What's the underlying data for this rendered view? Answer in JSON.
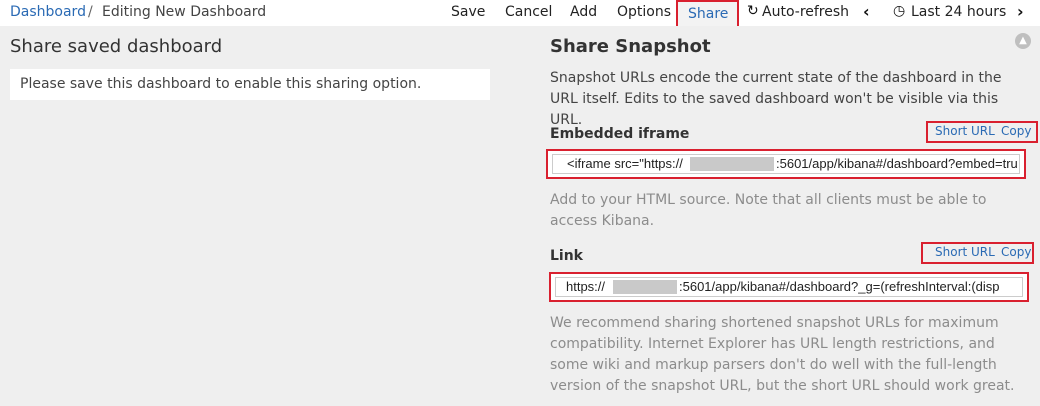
{
  "header": {
    "breadcrumb_root": "Dashboard",
    "breadcrumb_sep": "/",
    "breadcrumb_current": "Editing New Dashboard",
    "menu": {
      "save": "Save",
      "cancel": "Cancel",
      "add": "Add",
      "options": "Options",
      "share": "Share",
      "auto_refresh": "Auto-refresh",
      "time_range": "Last 24 hours"
    }
  },
  "left": {
    "title": "Share saved dashboard",
    "notice": "Please save this dashboard to enable this sharing option."
  },
  "right": {
    "title": "Share Snapshot",
    "description": "Snapshot URLs encode the current state of the dashboard in the URL itself. Edits to the saved dashboard won't be visible via this URL.",
    "iframe": {
      "label": "Embedded iframe",
      "short_url": "Short URL",
      "copy": "Copy",
      "value_prefix": "<iframe src=\"https://",
      "value_suffix": ":5601/app/kibana#/dashboard?embed=tru",
      "help": "Add to your HTML source. Note that all clients must be able to access Kibana."
    },
    "link": {
      "label": "Link",
      "short_url": "Short URL",
      "copy": "Copy",
      "value_prefix": "https://",
      "value_suffix": ":5601/app/kibana#/dashboard?_g=(refreshInterval:(disp",
      "help": "We recommend sharing shortened snapshot URLs for maximum compatibility. Internet Explorer has URL length restrictions, and some wiki and markup parsers don't do well with the full-length version of the snapshot URL, but the short URL should work great."
    }
  },
  "colors": {
    "link": "#2a6ab4",
    "highlight": "#d9202f",
    "panel_bg": "#efefef"
  }
}
